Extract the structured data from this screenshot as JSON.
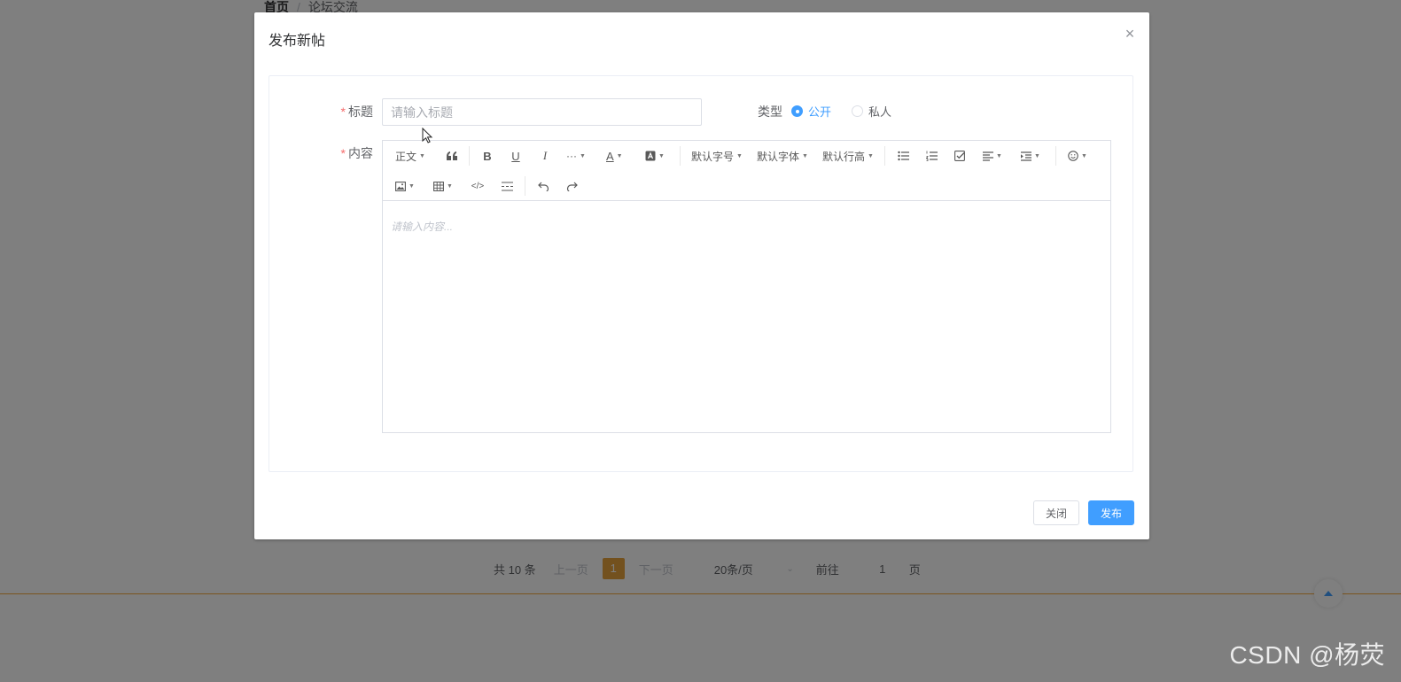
{
  "background": {
    "breadcrumb": {
      "home": "首页",
      "separator": "/",
      "current": "论坛交流"
    },
    "pagination": {
      "total": "共 10 条",
      "prev": "上一页",
      "current_page": "1",
      "next": "下一页",
      "page_size": "20条/页",
      "goto_label": "前往",
      "goto_value": "1",
      "goto_suffix": "页"
    },
    "accent_color": "#f5a83e",
    "pager_color": "#e6a23c"
  },
  "watermark": "CSDN @杨荧",
  "dialog": {
    "title": "发布新帖",
    "close_icon": "×",
    "form": {
      "title_label": "标题",
      "title_placeholder": "请输入标题",
      "title_value": "",
      "content_label": "内容",
      "required_mark": "*",
      "type_label": "类型",
      "type_options": [
        {
          "label": "公开",
          "checked": true
        },
        {
          "label": "私人",
          "checked": false
        }
      ],
      "editor": {
        "toolbar": {
          "paragraph": "正文",
          "font_size": "默认字号",
          "font_family": "默认字体",
          "line_height": "默认行高"
        },
        "placeholder": "请输入内容..."
      }
    },
    "buttons": {
      "close": "关闭",
      "publish": "发布"
    },
    "primary_color": "#409eff"
  }
}
